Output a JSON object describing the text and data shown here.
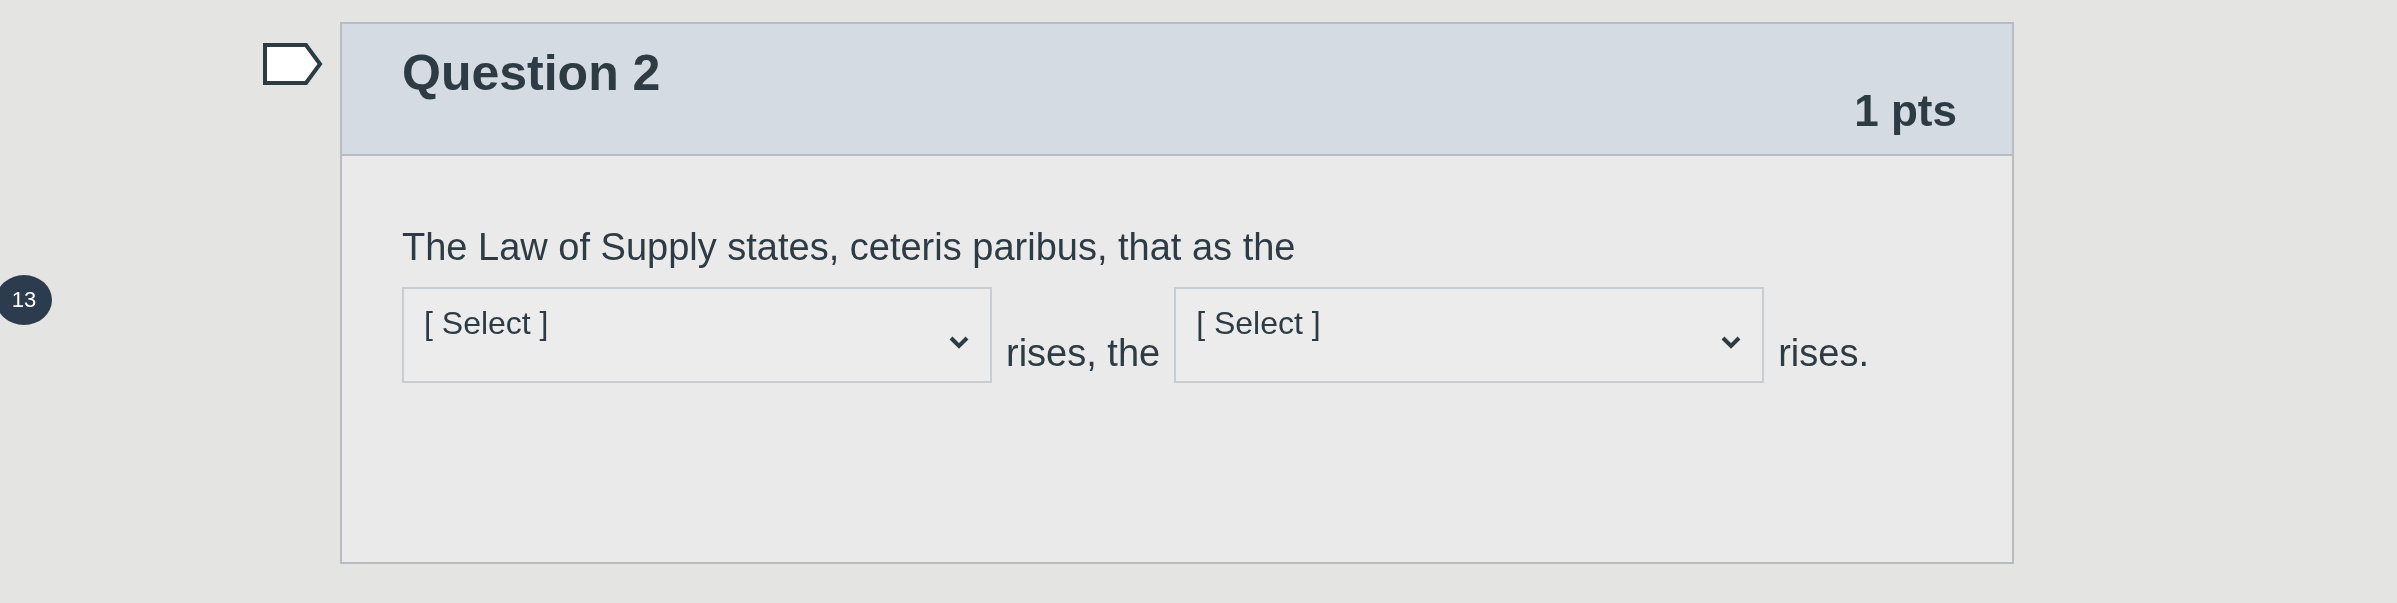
{
  "question_number": "13",
  "question": {
    "title": "Question 2",
    "points": "1 pts",
    "prompt": "The Law of Supply states, ceteris paribus, that as the",
    "answer_line": [
      {
        "kind": "select",
        "placeholder": "[ Select ]"
      },
      {
        "kind": "text",
        "text": "rises, the"
      },
      {
        "kind": "select",
        "placeholder": "[ Select ]"
      },
      {
        "kind": "text",
        "text": "rises."
      }
    ]
  }
}
